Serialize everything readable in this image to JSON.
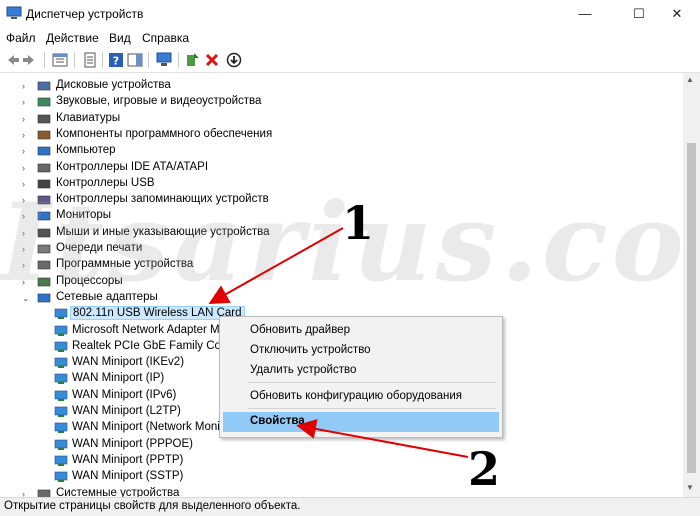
{
  "window": {
    "title": "Диспетчер устройств",
    "minimize": "—",
    "maximize": "☐",
    "close": "✕"
  },
  "menu": [
    "Файл",
    "Действие",
    "Вид",
    "Справка"
  ],
  "tree": {
    "categories": [
      "Дисковые устройства",
      "Звуковые, игровые и видеоустройства",
      "Клавиатуры",
      "Компоненты программного обеспечения",
      "Компьютер",
      "Контроллеры IDE ATA/ATAPI",
      "Контроллеры USB",
      "Контроллеры запоминающих устройств",
      "Мониторы",
      "Мыши и иные указывающие устройства",
      "Очереди печати",
      "Программные устройства",
      "Процессоры",
      "Сетевые адаптеры"
    ],
    "network_adapters": [
      "802.11n USB Wireless LAN Card",
      "Microsoft Network Adapter Mu",
      "Realtek PCIe GbE Family Contro",
      "WAN Miniport (IKEv2)",
      "WAN Miniport (IP)",
      "WAN Miniport (IPv6)",
      "WAN Miniport (L2TP)",
      "WAN Miniport (Network Moni",
      "WAN Miniport (PPPOE)",
      "WAN Miniport (PPTP)",
      "WAN Miniport (SSTP)"
    ],
    "partial_last": "Системные устройства"
  },
  "context_menu": {
    "items": [
      "Обновить драйвер",
      "Отключить устройство",
      "Удалить устройство",
      "Обновить конфигурацию оборудования",
      "Свойства"
    ]
  },
  "status": "Открытие страницы свойств для выделенного объекта.",
  "annotations": {
    "one": "1",
    "two": "2"
  },
  "watermark": "Itsarius.com",
  "colors": {
    "selection": "#cce8ff",
    "context_highlight": "#91c9f7",
    "arrow": "#e00000"
  }
}
